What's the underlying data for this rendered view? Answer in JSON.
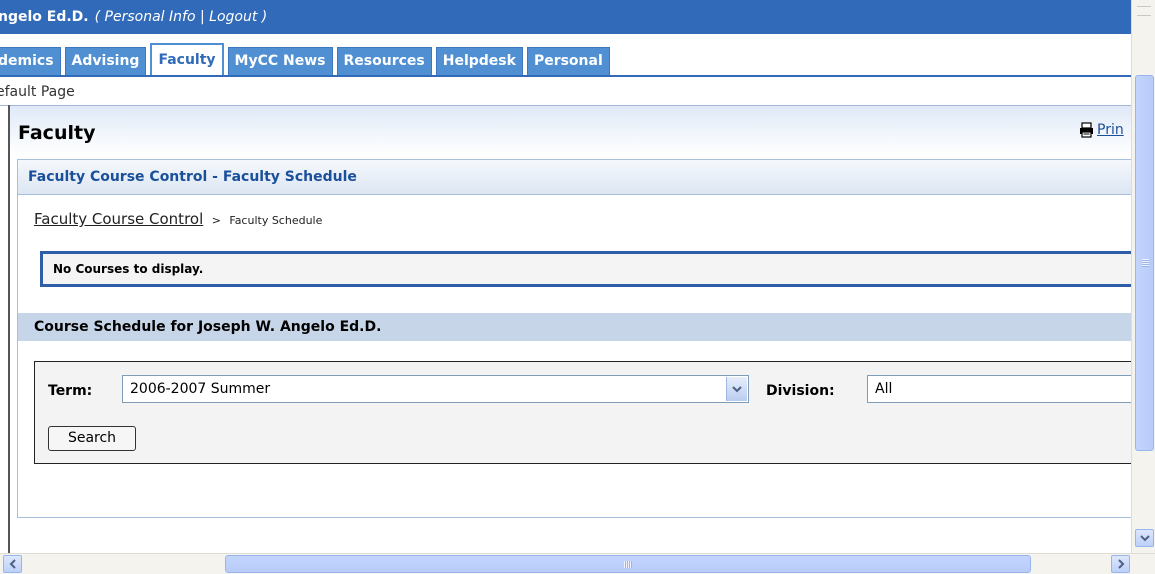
{
  "user_bar": {
    "name": "ngelo Ed.D.",
    "open_paren": "(",
    "personal_info": "Personal Info",
    "separator": "|",
    "logout": "Logout",
    "close_paren": ")"
  },
  "tabs": [
    {
      "label": "demics"
    },
    {
      "label": "Advising"
    },
    {
      "label": "Faculty",
      "active": true
    },
    {
      "label": "MyCC News"
    },
    {
      "label": "Resources"
    },
    {
      "label": "Helpdesk"
    },
    {
      "label": "Personal"
    }
  ],
  "subnav": {
    "label": "efault Page"
  },
  "page": {
    "title": "Faculty",
    "print_label": "Prin"
  },
  "panel": {
    "title": "Faculty Course Control - Faculty Schedule",
    "breadcrumb": {
      "link": "Faculty Course Control",
      "separator": ">",
      "current": "Faculty Schedule"
    },
    "message": "No Courses to display.",
    "schedule_heading": "Course Schedule for Joseph W. Angelo Ed.D."
  },
  "form": {
    "term_label": "Term:",
    "term_value": "2006-2007 Summer",
    "division_label": "Division:",
    "division_value": "All",
    "search_button": "Search"
  },
  "colors": {
    "header_blue": "#316ab8",
    "tab_blue": "#4f8fd2",
    "link_blue": "#1a4f9a",
    "message_border": "#2f5ea8",
    "section_band": "#c6d5e8"
  },
  "scrollbars": {
    "horizontal": {
      "left_arrow": "<",
      "right_arrow": ">"
    },
    "vertical": {
      "down_arrow": "v"
    }
  }
}
